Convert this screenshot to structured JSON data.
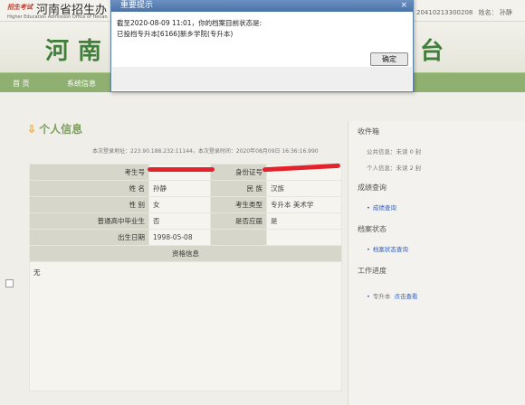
{
  "header": {
    "logo_text": "招生考试",
    "org_name": "河南省招生办",
    "org_name_en": "Higher Education Admission Office of Henan",
    "exam_id": "20410213300208",
    "name_label": "姓名：",
    "user_name": "孙静"
  },
  "banner": {
    "left": "河南",
    "right": "务平台"
  },
  "nav": {
    "items": [
      "首 页",
      "系统信息"
    ]
  },
  "section": {
    "title": "个人信息"
  },
  "login_info": {
    "ip_label": "本次登录地址：",
    "ip": "223.90.188.232:11144",
    "time_label": "本次登录时间：",
    "time": "2020年08月09日 16:36:16.990"
  },
  "table": {
    "exam_no_label": "考生号",
    "id_label": "身份证号",
    "name_label": "姓 名",
    "name_value": "孙静",
    "ethnicity_label": "民 族",
    "ethnicity_value": "汉族",
    "gender_label": "性 别",
    "gender_value": "女",
    "type_label": "考生类型",
    "type_value": "专升本 美术学",
    "hs_label": "普通高中毕业生",
    "hs_value": "否",
    "fresh_label": "是否应届",
    "fresh_value": "是",
    "birth_label": "出生日期",
    "birth_value": "1998-05-08",
    "qual_header": "资格信息",
    "qual_value": "无"
  },
  "right": {
    "inbox": "收件箱",
    "public_msg": "公共信息：未读",
    "public_count": "0",
    "personal_msg": "个人信息：未读",
    "personal_count": "2",
    "unit": "封",
    "scores": "成绩查询",
    "scores_link": "成绩查询",
    "archive": "档案状态",
    "archive_link": "档案状态查询",
    "progress": "工作进度",
    "progress_item": "专升本",
    "progress_link": "点击查看"
  },
  "dialog": {
    "title": "重要提示",
    "close": "×",
    "line1": "截至2020-08-09 11:01，你的档案目前状态是:",
    "line2": "已投档专升本[6166]新乡学院(专升本)",
    "ok": "确定"
  },
  "colors": {
    "nav": "#8fb070",
    "banner_text": "#3f7f3a",
    "dialog_title": "#4b73a8",
    "redaction": "#e3222b"
  }
}
